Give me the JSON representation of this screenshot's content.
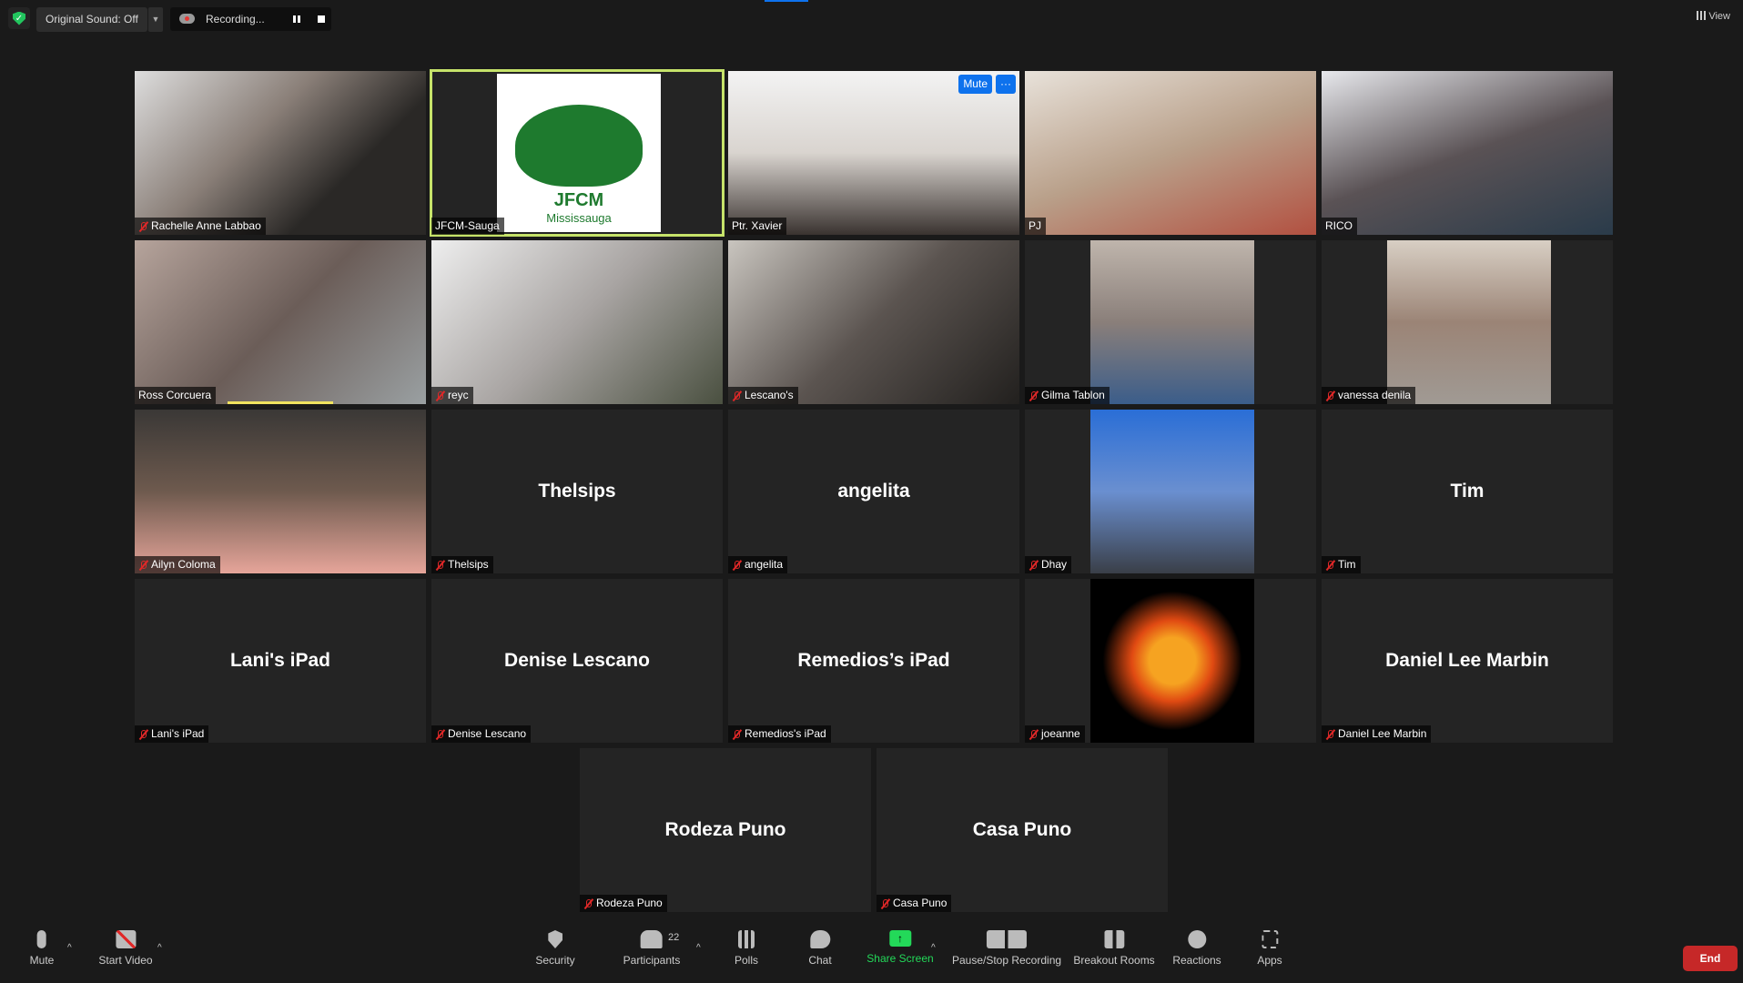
{
  "topbar": {
    "original_sound": "Original Sound: Off",
    "recording": "Recording...",
    "view": "View"
  },
  "colors": {
    "accent": "#0e72ed",
    "active_speaker": "#c6e36a",
    "muted": "#e02828",
    "share": "#23d959",
    "end": "#c62828"
  },
  "tiles": [
    {
      "name": "Rachelle Anne Labbao",
      "video": true,
      "muted": true,
      "bg": "linear-gradient(135deg,#ddd,#8a7f78 40%,#2a2826 70%)"
    },
    {
      "name": "JFCM-Sauga",
      "logo": {
        "title": "JFCM",
        "subtitle": "Mississauga"
      },
      "active": true,
      "muted": false
    },
    {
      "name": "Ptr. Xavier",
      "video": true,
      "muted": false,
      "buttons": [
        "Mute",
        "···"
      ],
      "bg": "linear-gradient(180deg,#f3f3f3,#d9d4cf 50%,#3a3330)"
    },
    {
      "name": "PJ",
      "video": true,
      "muted": false,
      "bg": "linear-gradient(160deg,#e8e2da,#b9a08a 50%,#b25040)"
    },
    {
      "name": "RICO",
      "video": true,
      "muted": false,
      "bg": "linear-gradient(160deg,#e7e8ec,#5a5255 50%,#2a3b4a)"
    },
    {
      "name": "Ross Corcuera",
      "video": true,
      "muted": false,
      "speaking": true,
      "bg": "linear-gradient(135deg,#b6a49c,#6b5d58 50%,#9aa0a2)"
    },
    {
      "name": "reyc",
      "video": true,
      "muted": true,
      "bg": "linear-gradient(135deg,#eee,#a8a4a2 50%,#4a5040)"
    },
    {
      "name": "Lescano's",
      "video": true,
      "muted": true,
      "bg": "linear-gradient(135deg,#c9c5bf,#5b5450 50%,#22201e)"
    },
    {
      "name": "Gilma Tablon",
      "video": true,
      "muted": true,
      "narrow": true,
      "bg": "linear-gradient(180deg,#bfb5ac,#8a7f7a 50%,#3b5d8a)"
    },
    {
      "name": "vanessa denila",
      "video": true,
      "muted": true,
      "narrow": true,
      "bg": "linear-gradient(180deg,#d8cfc4,#9b8476 50%,#a09a94)"
    },
    {
      "name": "Ailyn Coloma",
      "video": true,
      "muted": true,
      "bg": "linear-gradient(180deg,#3a3836,#6e5a4e 50%,#e6a59a)"
    },
    {
      "name": "Thelsips",
      "display": "Thelsips",
      "muted": true
    },
    {
      "name": "angelita",
      "display": "angelita",
      "muted": true
    },
    {
      "name": "Dhay",
      "video": true,
      "muted": true,
      "narrow": true,
      "bg": "linear-gradient(180deg,#2a6ed6,#6a8fd0 50%,#3a3f48)"
    },
    {
      "name": "Tim",
      "display": "Tim",
      "muted": true
    },
    {
      "name": "Lani's iPad",
      "display": "Lani's iPad",
      "muted": true
    },
    {
      "name": "Denise Lescano",
      "display": "Denise Lescano",
      "muted": true
    },
    {
      "name": "Remedios's iPad",
      "display": "Remedios’s iPad",
      "muted": true
    },
    {
      "name": "joeanne",
      "video": true,
      "muted": true,
      "narrow": true,
      "bg": "radial-gradient(circle,#f6a321 0 20%,#e04a12 35%,#000 60%)"
    },
    {
      "name": "Daniel Lee Marbin",
      "display": "Daniel Lee Marbin",
      "muted": true
    },
    {
      "name": "Rodeza Puno",
      "display": "Rodeza Puno",
      "muted": true
    },
    {
      "name": "Casa Puno",
      "display": "Casa Puno",
      "muted": true
    }
  ],
  "toolbar": {
    "mute": "Mute",
    "start_video": "Start Video",
    "security": "Security",
    "participants": "Participants",
    "participant_count": "22",
    "polls": "Polls",
    "chat": "Chat",
    "share_screen": "Share Screen",
    "record": "Pause/Stop Recording",
    "breakout": "Breakout Rooms",
    "reactions": "Reactions",
    "apps": "Apps",
    "end": "End"
  }
}
